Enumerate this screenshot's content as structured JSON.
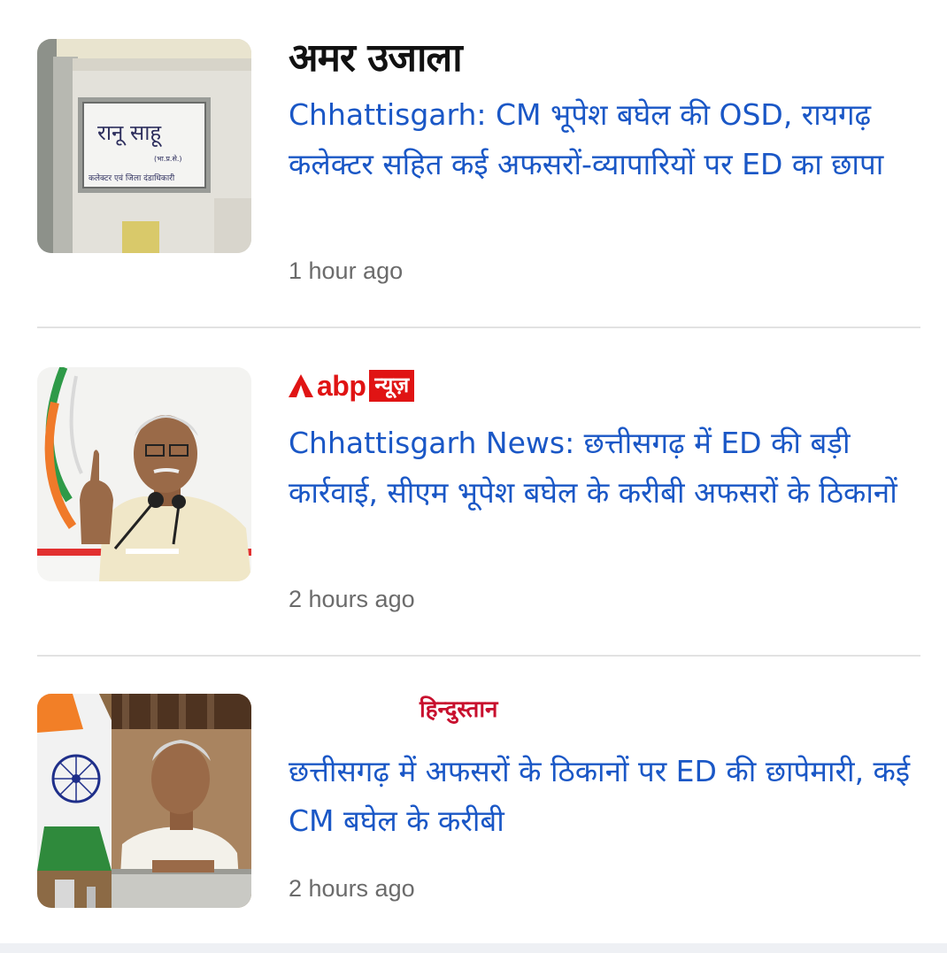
{
  "articles": [
    {
      "source": "अमर उजाला",
      "headline": "Chhattisgarh: CM भूपेश बघेल की OSD, रायगढ़ कलेक्टर सहित कई अफसरों-व्यापारियों पर ED का छापा",
      "time": "1 hour ago",
      "thumbnail_text": {
        "name": "रानू साहू",
        "line1": "(भा.प्र.से.)",
        "line2": "कलेक्टर एवं जिला दंडाधिकारी"
      }
    },
    {
      "source": {
        "brand": "abp",
        "tag": "न्यूज़"
      },
      "headline": "Chhattisgarh News: छत्तीसगढ़ में ED की बड़ी कार्रवाई, सीएम भूपेश बघेल के करीबी अफसरों के ठिकानों",
      "time": "2 hours ago"
    },
    {
      "source": "हिन्दुस्तान",
      "headline": "छत्तीसगढ़ में अफसरों के ठिकानों पर ED की छापेमारी, कई CM बघेल के करीबी",
      "time": "2 hours ago"
    }
  ],
  "colors": {
    "headline": "#1a57c6",
    "time": "#6b6b6b",
    "divider": "#e2e2e2",
    "abp_red": "#e01414",
    "hindustan_red": "#c8102e"
  }
}
